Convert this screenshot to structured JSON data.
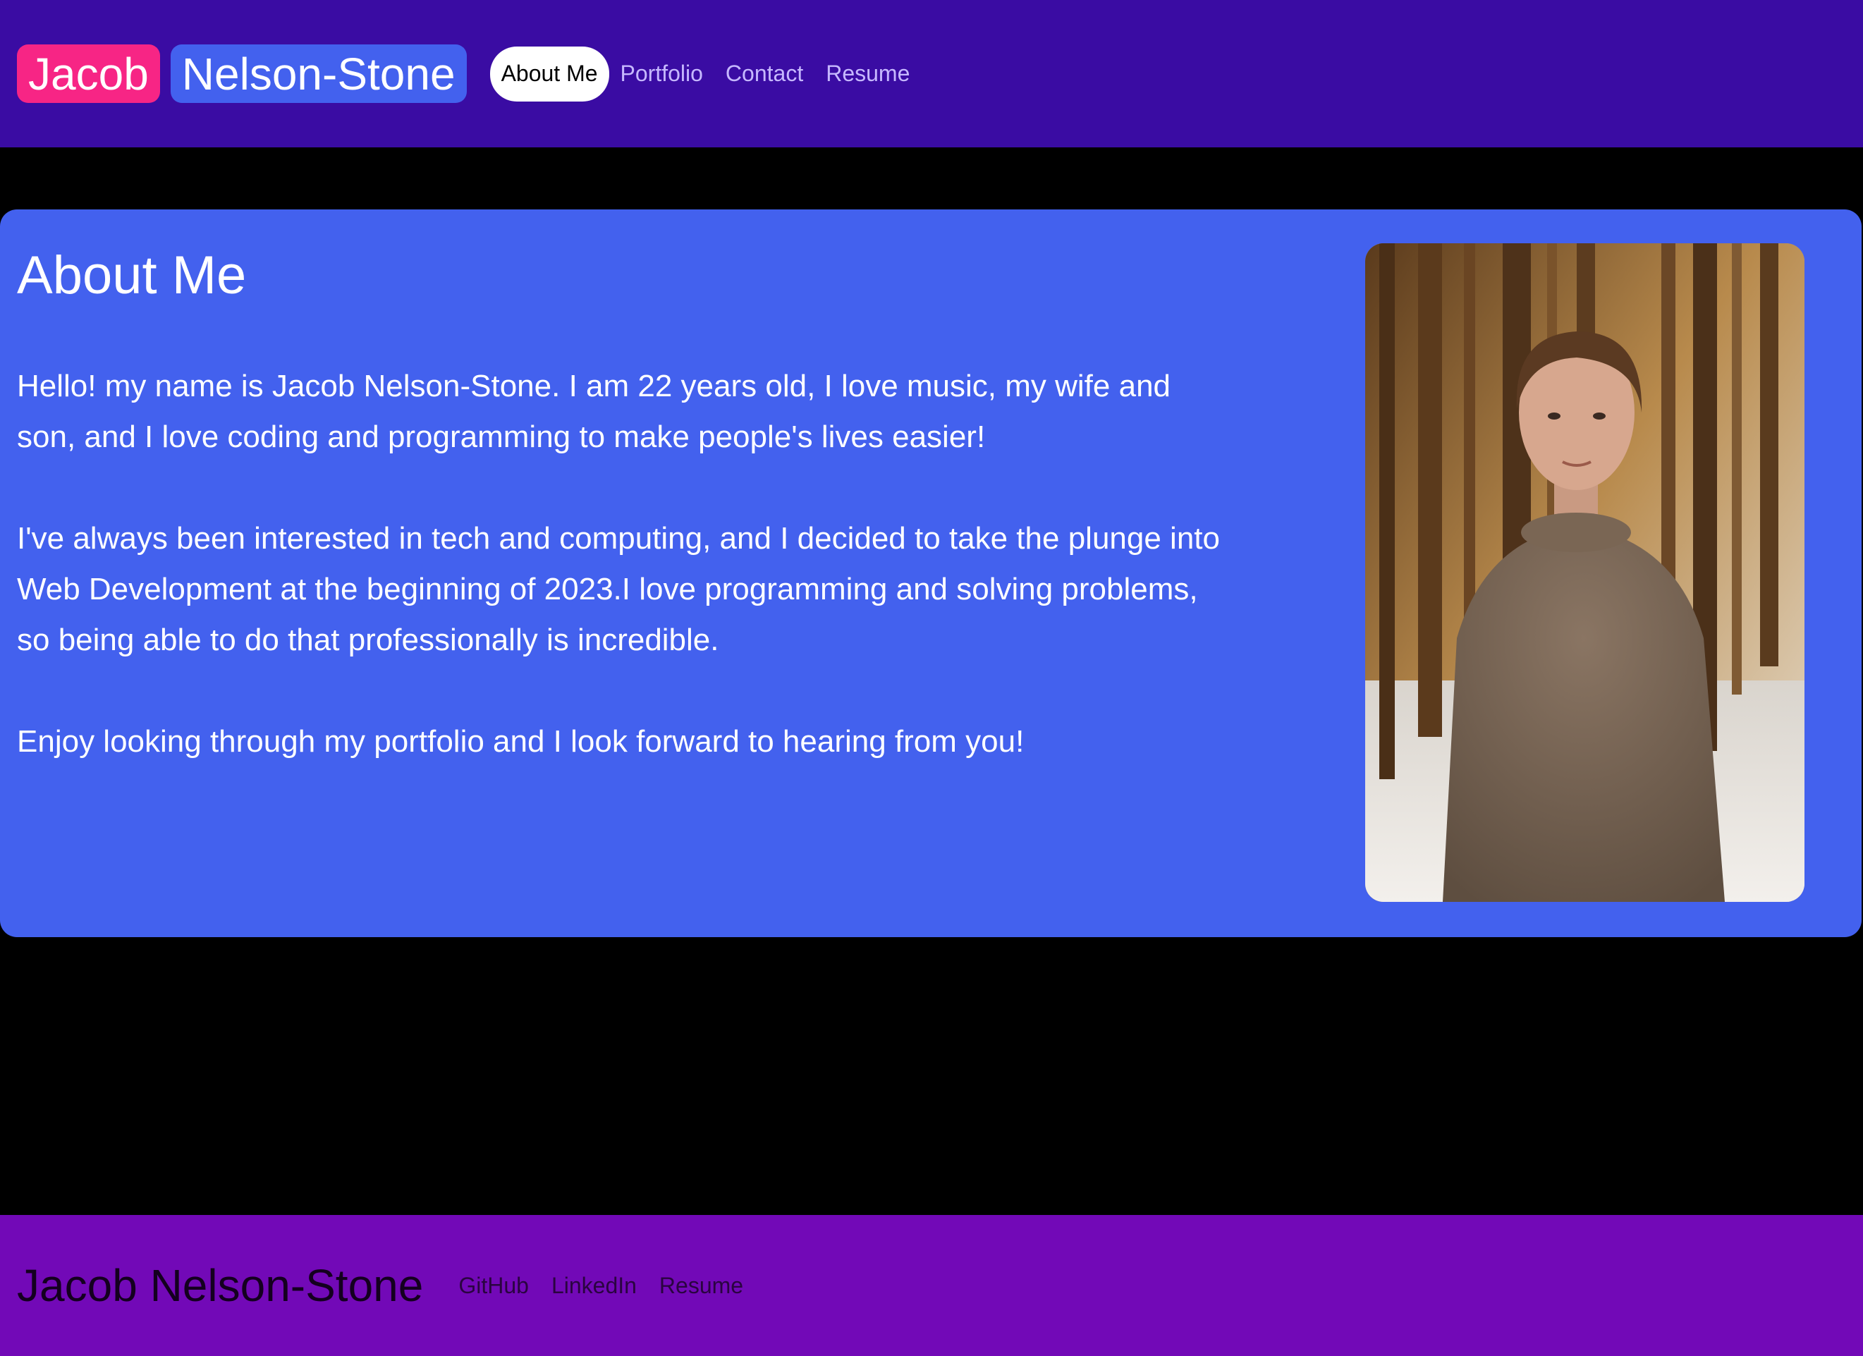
{
  "header": {
    "brand_first": "Jacob",
    "brand_last": "Nelson-Stone",
    "nav": [
      {
        "label": "About Me",
        "active": true
      },
      {
        "label": "Portfolio",
        "active": false
      },
      {
        "label": "Contact",
        "active": false
      },
      {
        "label": "Resume",
        "active": false
      }
    ]
  },
  "about": {
    "title": "About Me",
    "paragraphs": [
      "Hello! my name is Jacob Nelson-Stone. I am 22 years old, I love music, my wife and son, and I love coding and programming to make people's lives easier!",
      "I've always been interested in tech and computing, and I decided to take the plunge into Web Development at the beginning of 2023.I love programming and solving problems, so being able to do that professionally is incredible.",
      "Enjoy looking through my portfolio and I look forward to hearing from you!"
    ]
  },
  "footer": {
    "name": "Jacob Nelson-Stone",
    "links": [
      "GitHub",
      "LinkedIn",
      "Resume"
    ]
  },
  "colors": {
    "header_bg": "#3a0ca3",
    "brand_first_bg": "#f72585",
    "brand_last_bg": "#4361ee",
    "card_bg": "#4361ee",
    "footer_bg": "#7209b7",
    "page_bg": "#000000"
  }
}
